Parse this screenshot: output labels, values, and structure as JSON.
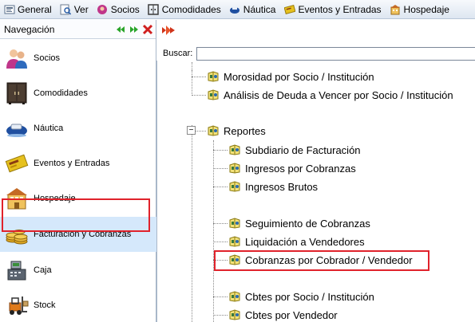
{
  "menu": {
    "items": [
      {
        "label": "General",
        "icon": "general-icon"
      },
      {
        "label": "Ver",
        "icon": "view-icon"
      },
      {
        "label": "Socios",
        "icon": "socios-icon"
      },
      {
        "label": "Comodidades",
        "icon": "comodidades-icon"
      },
      {
        "label": "Náutica",
        "icon": "nautica-icon"
      },
      {
        "label": "Eventos y Entradas",
        "icon": "eventos-icon"
      },
      {
        "label": "Hospedaje",
        "icon": "hospedaje-icon"
      }
    ]
  },
  "navigation": {
    "title": "Navegación",
    "items": [
      {
        "label": "Socios",
        "icon": "people-icon"
      },
      {
        "label": "Comodidades",
        "icon": "wardrobe-icon"
      },
      {
        "label": "Náutica",
        "icon": "boat-icon"
      },
      {
        "label": "Eventos y Entradas",
        "icon": "ticket-icon"
      },
      {
        "label": "Hospedaje",
        "icon": "hotel-icon"
      },
      {
        "label": "Facturación y Cobranzas",
        "icon": "coins-icon",
        "selected": true
      },
      {
        "label": "Caja",
        "icon": "cash-register-icon"
      },
      {
        "label": "Stock",
        "icon": "forklift-icon"
      }
    ]
  },
  "search": {
    "label": "Buscar:",
    "value": ""
  },
  "tree": {
    "items": [
      {
        "label": "Morosidad por Socio / Institución",
        "level": 1
      },
      {
        "label": "Análisis de Deuda a Vencer por Socio / Institución",
        "level": 1
      },
      {
        "label": "Reportes",
        "level": 1,
        "expanded": true
      },
      {
        "label": "Subdiario de Facturación",
        "level": 2
      },
      {
        "label": "Ingresos por Cobranzas",
        "level": 2
      },
      {
        "label": "Ingresos Brutos",
        "level": 2
      },
      {
        "label": "Seguimiento de Cobranzas",
        "level": 2
      },
      {
        "label": "Liquidación a Vendedores",
        "level": 2
      },
      {
        "label": "Cobranzas por Cobrador / Vendedor",
        "level": 2,
        "highlighted": true
      },
      {
        "label": "Cbtes por Socio / Institución",
        "level": 2
      },
      {
        "label": "Cbtes por Vendedor",
        "level": 2
      }
    ]
  },
  "colors": {
    "highlight": "#e0222b",
    "selected_bg": "#d5e8fb",
    "menubar": "#dde6f1"
  }
}
